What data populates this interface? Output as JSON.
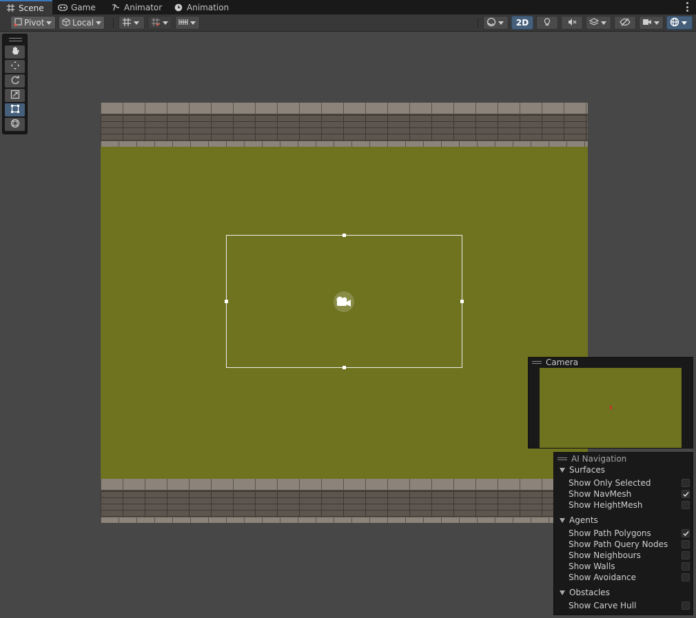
{
  "tabs": [
    {
      "label": "Scene",
      "icon": "grid-icon",
      "active": true
    },
    {
      "label": "Game",
      "icon": "gamepad-icon",
      "active": false
    },
    {
      "label": "Animator",
      "icon": "animator-icon",
      "active": false
    },
    {
      "label": "Animation",
      "icon": "clock-icon",
      "active": false
    }
  ],
  "toolbar": {
    "pivot_label": "Pivot",
    "local_label": "Local",
    "mode_2d_label": "2D"
  },
  "camera_overlay": {
    "title": "Camera"
  },
  "ai_navigation": {
    "title": "AI Navigation",
    "surfaces": {
      "title": "Surfaces",
      "options": [
        {
          "label": "Show Only Selected",
          "checked": false
        },
        {
          "label": "Show NavMesh",
          "checked": true
        },
        {
          "label": "Show HeightMesh",
          "checked": false
        }
      ]
    },
    "agents": {
      "title": "Agents",
      "options": [
        {
          "label": "Show Path Polygons",
          "checked": true
        },
        {
          "label": "Show Path Query Nodes",
          "checked": false
        },
        {
          "label": "Show Neighbours",
          "checked": false
        },
        {
          "label": "Show Walls",
          "checked": false
        },
        {
          "label": "Show Avoidance",
          "checked": false
        }
      ]
    },
    "obstacles": {
      "title": "Obstacles",
      "options": [
        {
          "label": "Show Carve Hull",
          "checked": false
        }
      ]
    }
  },
  "colors": {
    "accent": "#3a79bb",
    "selected_button": "#46607c",
    "grass": "#6f731f",
    "wall": "#5d564f"
  }
}
